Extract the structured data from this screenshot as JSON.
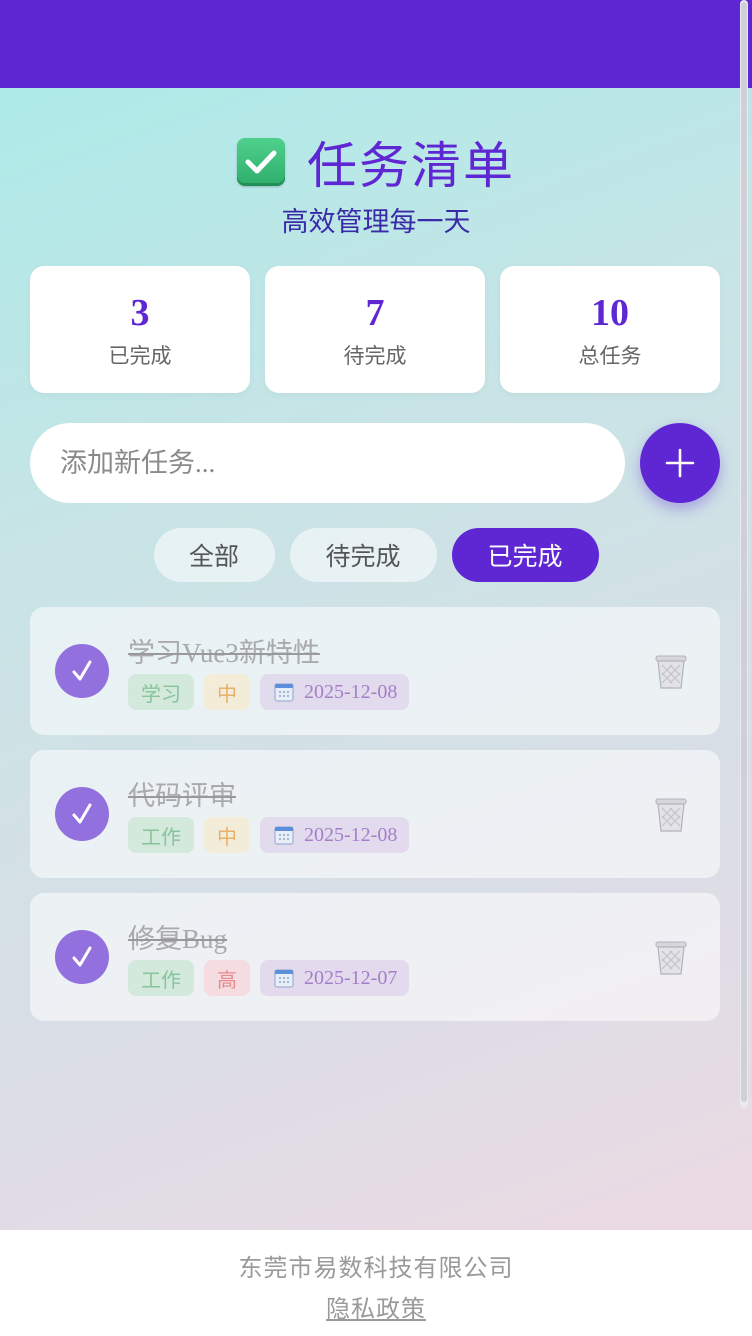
{
  "header": {
    "title": "任务清单",
    "subtitle": "高效管理每一天",
    "icon": "check-mark-button-emoji"
  },
  "stats": [
    {
      "value": "3",
      "label": "已完成"
    },
    {
      "value": "7",
      "label": "待完成"
    },
    {
      "value": "10",
      "label": "总任务"
    }
  ],
  "add_task": {
    "placeholder": "添加新任务...",
    "button_icon": "plus-icon"
  },
  "filters": [
    {
      "label": "全部",
      "active": false
    },
    {
      "label": "待完成",
      "active": false
    },
    {
      "label": "已完成",
      "active": true
    }
  ],
  "tasks": [
    {
      "title": "学习Vue3新特性",
      "category": "学习",
      "priority": "中",
      "date": "2025-12-08",
      "completed": true
    },
    {
      "title": "代码评审",
      "category": "工作",
      "priority": "中",
      "date": "2025-12-08",
      "completed": true
    },
    {
      "title": "修复Bug",
      "category": "工作",
      "priority": "高",
      "date": "2025-12-07",
      "completed": true
    }
  ],
  "footer": {
    "company": "东莞市易数科技有限公司",
    "privacy": "隐私政策"
  },
  "colors": {
    "accent": "#5e27d3",
    "check_circle": "#9271df"
  }
}
